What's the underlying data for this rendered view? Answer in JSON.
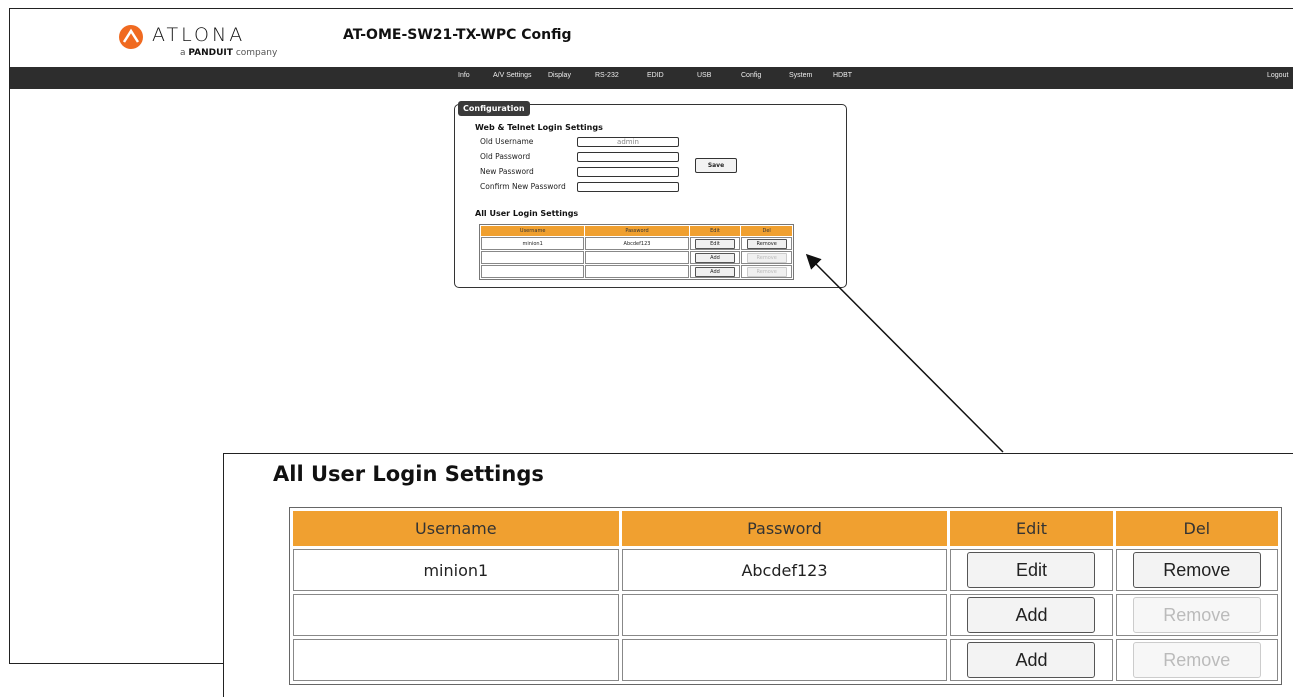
{
  "brand": {
    "name": "ATLONA",
    "sub_prefix": "a",
    "sub_brand": "PANDUIT",
    "sub_suffix": "company",
    "accent": "#f0a030"
  },
  "header": {
    "title": "AT-OME-SW21-TX-WPC  Config"
  },
  "nav": {
    "items": [
      "Info",
      "A/V Settings",
      "Display",
      "RS-232",
      "EDID",
      "USB",
      "Config",
      "System",
      "HDBT"
    ],
    "logout": "Logout"
  },
  "panel": {
    "tab": "Configuration",
    "web_section": {
      "title": "Web & Telnet Login Settings",
      "fields": [
        {
          "label": "Old Username",
          "value": "admin"
        },
        {
          "label": "Old Password",
          "value": ""
        },
        {
          "label": "New Password",
          "value": ""
        },
        {
          "label": "Confirm New Password",
          "value": ""
        }
      ],
      "save": "Save"
    },
    "users_section": {
      "title": "All User Login Settings",
      "headers": [
        "Username",
        "Password",
        "Edit",
        "Del"
      ],
      "rows": [
        {
          "username": "minion1",
          "password": "Abcdef123",
          "edit": "Edit",
          "del": "Remove",
          "del_enabled": true
        },
        {
          "username": "",
          "password": "",
          "edit": "Add",
          "del": "Remove",
          "del_enabled": false
        },
        {
          "username": "",
          "password": "",
          "edit": "Add",
          "del": "Remove",
          "del_enabled": false
        }
      ]
    }
  },
  "zoom": {
    "title": "All User Login Settings"
  }
}
